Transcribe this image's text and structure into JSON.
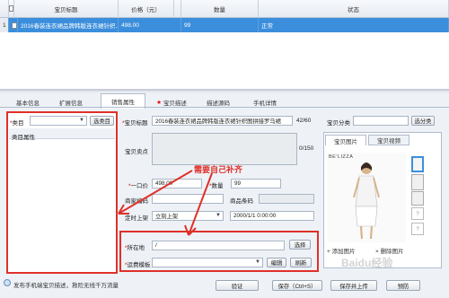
{
  "table": {
    "headers": [
      "宝贝标题",
      "价格（元）",
      "数量",
      "状态"
    ],
    "row": {
      "index": "1",
      "title": "2016春装连衣裙品牌韩版连衣裙针织...",
      "price": "498.00",
      "quantity": "99",
      "status": "正常"
    }
  },
  "tabs": [
    "基本信息",
    "扩展信息",
    "销售属性",
    "宝贝描述",
    "描述源码",
    "手机详情"
  ],
  "left": {
    "category_label": "类目",
    "category_value": "",
    "select_button": "选类目",
    "attr_header": "类目属性"
  },
  "form": {
    "title_label": "宝贝标题",
    "title_value": "2016春装连衣裙品牌韩版连衣裙针织图拼接罗马裙",
    "title_count": "42/60",
    "category_label": "宝贝分类",
    "category_button": "选分类",
    "selling_label": "宝贝卖点",
    "selling_count": "0/150",
    "price_label": "一口价",
    "price_value": "498.00",
    "qty_label": "数量",
    "qty_value": "99",
    "code_label": "商家编码",
    "barcode_label": "商品条码",
    "listing_label": "定时上架",
    "listing_value": "立刻上架",
    "listing_time": "2000/1/1 0:00:00",
    "location_label": "所在地",
    "location_value": "/",
    "location_button": "选择",
    "shipping_label": "运费模板",
    "edit_button": "编辑",
    "refresh_button": "刷新"
  },
  "annotation": "需要自己补齐",
  "pictures": {
    "tab_images": "宝贝图片",
    "tab_video": "宝贝视频",
    "brand": "BE'LIZZA",
    "add_pic": "+ 添加图片",
    "del_pic": "× 删除图片",
    "placeholders": [
      "?",
      "?"
    ]
  },
  "footer": {
    "checkbox_label": "发布手机端宝贝描述，救险无线千万流量",
    "verify_button": "验证",
    "save_button": "保存（Ctrl+S）",
    "save_upload_button": "保存并上传",
    "extra_button": "预防"
  },
  "watermark": "Baidu经验",
  "colors": {
    "selection": "#3b8edb",
    "highlight": "#e0302a"
  }
}
